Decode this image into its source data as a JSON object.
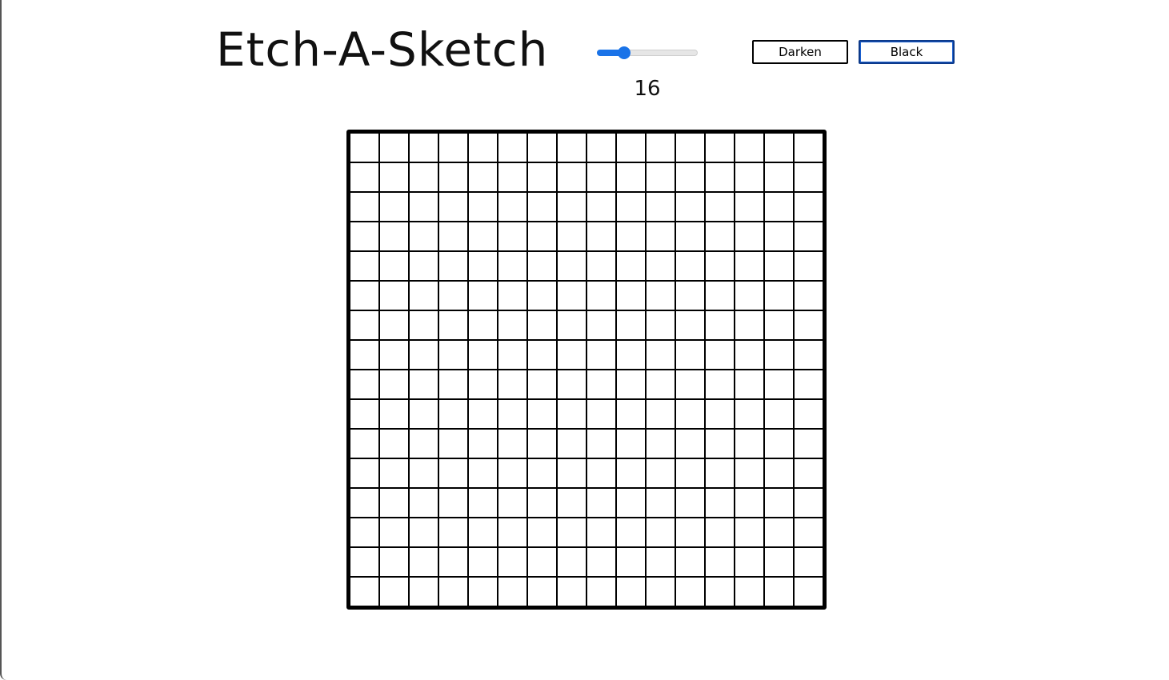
{
  "app": {
    "title": "Etch-A-Sketch"
  },
  "controls": {
    "grid_size_slider": {
      "value": 16,
      "min": 1,
      "max": 64,
      "accent": "#1a73e8"
    },
    "grid_size_readout": "16",
    "darken_button": "Darken",
    "black_button": "Black"
  },
  "grid": {
    "rows": 16,
    "cols": 16,
    "line_color": "#000000",
    "cell_color": "#ffffff"
  }
}
